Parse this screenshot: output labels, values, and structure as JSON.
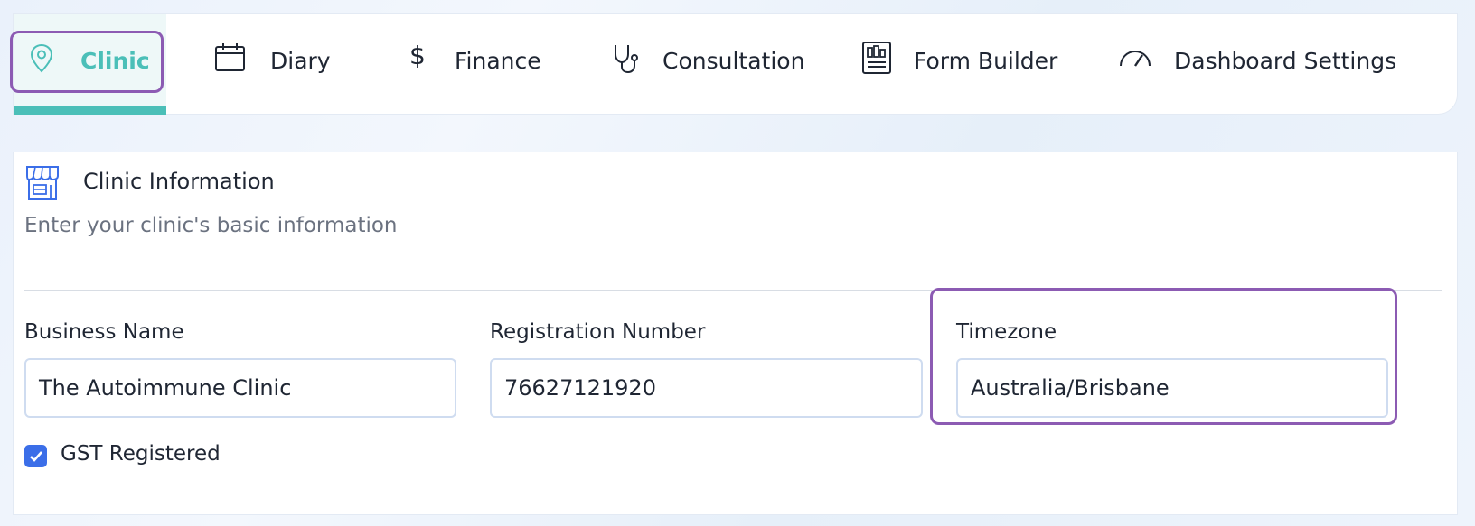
{
  "nav": {
    "tabs": [
      {
        "label": "Clinic",
        "icon": "map-pin-icon",
        "active": true
      },
      {
        "label": "Diary",
        "icon": "calendar-icon",
        "active": false
      },
      {
        "label": "Finance",
        "icon": "dollar-icon",
        "active": false
      },
      {
        "label": "Consultation",
        "icon": "stethoscope-icon",
        "active": false
      },
      {
        "label": "Form Builder",
        "icon": "form-icon",
        "active": false
      },
      {
        "label": "Dashboard Settings",
        "icon": "gauge-icon",
        "active": false
      }
    ]
  },
  "section": {
    "title": "Clinic Information",
    "subtitle": "Enter your clinic's basic information",
    "icon": "storefront-icon"
  },
  "fields": {
    "business_name": {
      "label": "Business Name",
      "value": "The Autoimmune Clinic"
    },
    "registration_number": {
      "label": "Registration Number",
      "value": "76627121920"
    },
    "timezone": {
      "label": "Timezone",
      "value": "Australia/Brisbane"
    }
  },
  "gst": {
    "label": "GST Registered",
    "checked": true
  },
  "colors": {
    "accent": "#4bbfb8",
    "highlight": "#8c5bb3",
    "checkbox": "#3b6ee8"
  }
}
